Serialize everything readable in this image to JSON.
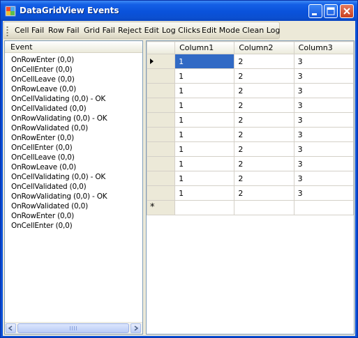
{
  "window": {
    "title": "DataGridView Events"
  },
  "toolbar": {
    "items": [
      "Cell Fail",
      "Row Fail",
      "Grid Fail",
      "Reject Edit",
      "Log Clicks",
      "Edit Mode",
      "Clean Log"
    ]
  },
  "log": {
    "header": "Event",
    "entries": [
      "OnRowEnter (0,0)",
      "OnCellEnter (0,0)",
      "OnCellLeave (0,0)",
      "OnRowLeave (0,0)",
      "OnCellValidating (0,0) - OK",
      "OnCellValidated (0,0)",
      "OnRowValidating (0,0) - OK",
      "OnRowValidated (0,0)",
      "OnRowEnter (0,0)",
      "OnCellEnter (0,0)",
      "OnCellLeave (0,0)",
      "OnRowLeave (0,0)",
      "OnCellValidating (0,0) - OK",
      "OnCellValidated (0,0)",
      "OnRowValidating (0,0) - OK",
      "OnRowValidated (0,0)",
      "OnRowEnter (0,0)",
      "OnCellEnter (0,0)"
    ]
  },
  "grid": {
    "columns": [
      "Column1",
      "Column2",
      "Column3"
    ],
    "rows": [
      [
        "1",
        "2",
        "3"
      ],
      [
        "1",
        "2",
        "3"
      ],
      [
        "1",
        "2",
        "3"
      ],
      [
        "1",
        "2",
        "3"
      ],
      [
        "1",
        "2",
        "3"
      ],
      [
        "1",
        "2",
        "3"
      ],
      [
        "1",
        "2",
        "3"
      ],
      [
        "1",
        "2",
        "3"
      ],
      [
        "1",
        "2",
        "3"
      ],
      [
        "1",
        "2",
        "3"
      ]
    ],
    "new_row_marker": "*",
    "current_row": 0,
    "selected_cell": [
      0,
      0
    ]
  },
  "colors": {
    "title_bar": "#0a52db",
    "selection": "#316ac5",
    "panel_background": "#ece9d8"
  }
}
